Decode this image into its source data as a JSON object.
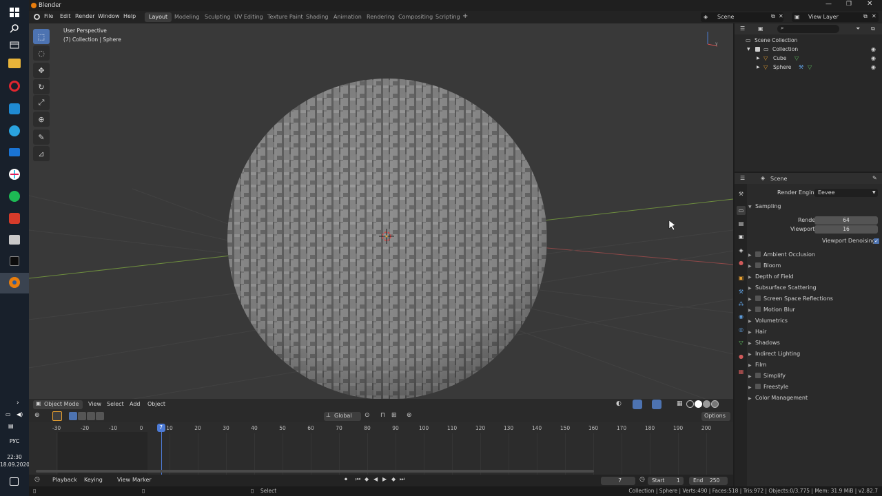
{
  "taskbar": {
    "icons": [
      "windows-icon",
      "search-icon",
      "task-view-icon",
      "file-explorer-icon",
      "opera-icon",
      "vscode-icon",
      "telegram-icon",
      "mail-icon",
      "slack-icon",
      "spotify-icon",
      "app-red-icon",
      "app-gray-icon",
      "app-dark-icon",
      "blender-icon"
    ],
    "tray": {
      "lang": "РУС",
      "time": "22:30",
      "date": "18.09.2020"
    }
  },
  "window": {
    "title": "Blender"
  },
  "menubar": {
    "menus": [
      "File",
      "Edit",
      "Render",
      "Window",
      "Help"
    ],
    "workspaces": [
      "Layout",
      "Modeling",
      "Sculpting",
      "UV Editing",
      "Texture Paint",
      "Shading",
      "Animation",
      "Rendering",
      "Compositing",
      "Scripting"
    ],
    "active_workspace": "Layout",
    "scene": "Scene",
    "view_layer": "View Layer"
  },
  "viewport": {
    "perspective": "User Perspective",
    "collection_info": "(7) Collection | Sphere",
    "background_color": "#393939",
    "mesh_color": "#7d7d7d",
    "mode": "Object Mode",
    "menus": [
      "View",
      "Select",
      "Add",
      "Object"
    ],
    "transform_orientation": "Global",
    "options_label": "Options",
    "tools": [
      "select-box-icon",
      "cursor-icon",
      "move-icon",
      "rotate-icon",
      "scale-icon",
      "transform-icon",
      "annotate-icon",
      "measure-icon"
    ]
  },
  "timeline": {
    "ticks": [
      "-30",
      "-20",
      "-10",
      "0",
      "10",
      "20",
      "30",
      "40",
      "50",
      "60",
      "70",
      "80",
      "90",
      "100",
      "110",
      "120",
      "130",
      "140",
      "150",
      "160",
      "170",
      "180",
      "190",
      "200"
    ],
    "current_frame": "7",
    "menus": [
      "Playback",
      "Keying",
      "View",
      "Marker"
    ],
    "start_label": "Start",
    "start": "1",
    "end_label": "End",
    "end": "250"
  },
  "outliner": {
    "scene_collection": "Scene Collection",
    "collection": "Collection",
    "objects": [
      {
        "name": "Cube"
      },
      {
        "name": "Sphere"
      }
    ]
  },
  "properties": {
    "context": "Scene",
    "render_engine_label": "Render Engine",
    "render_engine": "Eevee",
    "sampling": {
      "title": "Sampling",
      "render_label": "Render",
      "render": "64",
      "viewport_label": "Viewport",
      "viewport": "16",
      "denoise_label": "Viewport Denoising"
    },
    "panels": [
      {
        "label": "Ambient Occlusion",
        "checkbox": true
      },
      {
        "label": "Bloom",
        "checkbox": true
      },
      {
        "label": "Depth of Field",
        "checkbox": false
      },
      {
        "label": "Subsurface Scattering",
        "checkbox": false
      },
      {
        "label": "Screen Space Reflections",
        "checkbox": true
      },
      {
        "label": "Motion Blur",
        "checkbox": true
      },
      {
        "label": "Volumetrics",
        "checkbox": false
      },
      {
        "label": "Hair",
        "checkbox": false
      },
      {
        "label": "Shadows",
        "checkbox": false
      },
      {
        "label": "Indirect Lighting",
        "checkbox": false
      },
      {
        "label": "Film",
        "checkbox": false
      },
      {
        "label": "Simplify",
        "checkbox": true
      },
      {
        "label": "Freestyle",
        "checkbox": true
      },
      {
        "label": "Color Management",
        "checkbox": false
      }
    ]
  },
  "statusbar": {
    "select": "Select",
    "info": "Collection | Sphere | Verts:490 | Faces:518 | Tris:972 | Objects:0/3,775 | Mem: 31.9 MiB | v2.82.7"
  }
}
